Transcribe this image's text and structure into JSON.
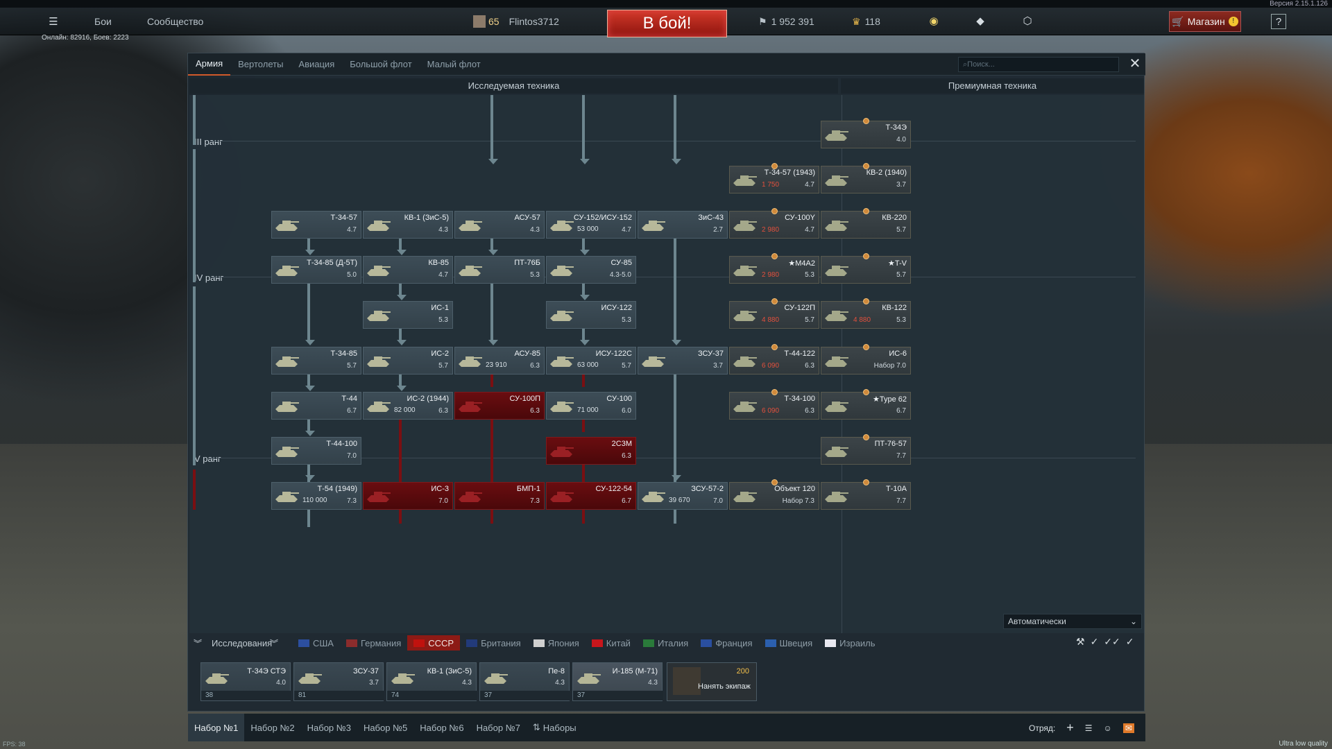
{
  "version": "Версия 2.15.1.126",
  "topbar": {
    "battles": "Бои",
    "community": "Сообщество",
    "level": "65",
    "player": "Flintos3712",
    "to_battle": "В бой!",
    "silver": "1 952 391",
    "gold": "118",
    "shop": "Магазин",
    "online": "Онлайн: 82916, Боев: 2223"
  },
  "tabs": [
    "Армия",
    "Вертолеты",
    "Авиация",
    "Большой флот",
    "Малый флот"
  ],
  "search_placeholder": "Поиск...",
  "headers": {
    "researched": "Исследуемая техника",
    "premium": "Премиумная техника"
  },
  "ranks": [
    "III ранг",
    "IV ранг",
    "V ранг"
  ],
  "tree": [
    {
      "name": "Т-34-57",
      "br": "4.7",
      "rp": ""
    },
    {
      "name": "КВ-1 (ЗиС-5)",
      "br": "4.3",
      "rp": ""
    },
    {
      "name": "АСУ-57",
      "br": "4.3",
      "rp": ""
    },
    {
      "name": "СУ-152/ИСУ-152",
      "br": "4.7",
      "rp": "53 000"
    },
    {
      "name": "ЗиС-43",
      "br": "2.7",
      "rp": ""
    },
    {
      "name": "Т-34-85 (Д-5Т)",
      "br": "5.0",
      "rp": ""
    },
    {
      "name": "КВ-85",
      "br": "4.7",
      "rp": ""
    },
    {
      "name": "ПТ-76Б",
      "br": "5.3",
      "rp": ""
    },
    {
      "name": "СУ-85",
      "br": "4.3-5.0",
      "rp": ""
    },
    {
      "name": "ИС-1",
      "br": "5.3",
      "rp": ""
    },
    {
      "name": "ИСУ-122",
      "br": "5.3",
      "rp": ""
    },
    {
      "name": "Т-34-85",
      "br": "5.7",
      "rp": ""
    },
    {
      "name": "ИС-2",
      "br": "5.7",
      "rp": ""
    },
    {
      "name": "АСУ-85",
      "br": "6.3",
      "rp": "23 910"
    },
    {
      "name": "ИСУ-122С",
      "br": "5.7",
      "rp": "63 000"
    },
    {
      "name": "ЗСУ-37",
      "br": "3.7",
      "rp": ""
    },
    {
      "name": "Т-44",
      "br": "6.7",
      "rp": ""
    },
    {
      "name": "ИС-2 (1944)",
      "br": "6.3",
      "rp": "82 000"
    },
    {
      "name": "СУ-100П",
      "br": "6.3",
      "rp": ""
    },
    {
      "name": "СУ-100",
      "br": "6.0",
      "rp": "71 000"
    },
    {
      "name": "Т-44-100",
      "br": "7.0",
      "rp": ""
    },
    {
      "name": "2С3М",
      "br": "6.3",
      "rp": ""
    },
    {
      "name": "Т-54 (1949)",
      "br": "7.3",
      "rp": "110 000"
    },
    {
      "name": "ИС-3",
      "br": "7.0",
      "rp": ""
    },
    {
      "name": "БМП-1",
      "br": "7.3",
      "rp": ""
    },
    {
      "name": "СУ-122-54",
      "br": "6.7",
      "rp": ""
    },
    {
      "name": "ЗСУ-57-2",
      "br": "7.0",
      "rp": "39 670"
    }
  ],
  "premium": [
    {
      "name": "Т-34Э",
      "br": "4.0",
      "price": ""
    },
    {
      "name": "Т-34-57 (1943)",
      "br": "4.7",
      "price": "1 750"
    },
    {
      "name": "КВ-2 (1940)",
      "br": "3.7",
      "price": ""
    },
    {
      "name": "СУ-100Y",
      "br": "4.7",
      "price": "2 980"
    },
    {
      "name": "КВ-220",
      "br": "5.7",
      "price": ""
    },
    {
      "name": "★M4A2",
      "br": "5.3",
      "price": "2 980"
    },
    {
      "name": "★T-V",
      "br": "5.7",
      "price": ""
    },
    {
      "name": "СУ-122П",
      "br": "5.7",
      "price": "4 880"
    },
    {
      "name": "КВ-122",
      "br": "5.3",
      "price": "4 880"
    },
    {
      "name": "Т-44-122",
      "br": "6.3",
      "price": "6 090"
    },
    {
      "name": "ИС-6",
      "br": "Набор 7.0",
      "price": ""
    },
    {
      "name": "Т-34-100",
      "br": "6.3",
      "price": "6 090"
    },
    {
      "name": "★Type 62",
      "br": "6.7",
      "price": ""
    },
    {
      "name": "ПТ-76-57",
      "br": "7.7",
      "price": ""
    },
    {
      "name": "Объект 120",
      "br": "Набор 7.3",
      "price": ""
    },
    {
      "name": "Т-10А",
      "br": "7.7",
      "price": ""
    }
  ],
  "auto_select": "Автоматически",
  "research_label": "Исследования",
  "nations": [
    "США",
    "Германия",
    "СССР",
    "Британия",
    "Япония",
    "Китай",
    "Италия",
    "Франция",
    "Швеция",
    "Израиль"
  ],
  "crew": [
    {
      "name": "Т-34Э СТЭ",
      "br": "4.0",
      "foot": "38"
    },
    {
      "name": "ЗСУ-37",
      "br": "3.7",
      "foot": "81"
    },
    {
      "name": "КВ-1 (ЗиС-5)",
      "br": "4.3",
      "foot": "74"
    },
    {
      "name": "Пе-8",
      "br": "4.3",
      "foot": "37"
    },
    {
      "name": "И-185 (М-71)",
      "br": "4.3",
      "foot": "37"
    }
  ],
  "hire": {
    "label": "Нанять экипаж",
    "cost": "200"
  },
  "presets": [
    "Набор №1",
    "Набор №2",
    "Набор №3",
    "Набор №5",
    "Набор №6",
    "Набор №7",
    "Наборы"
  ],
  "squad": "Отряд:",
  "fps": "FPS: 38",
  "quality": "Ultra low quality"
}
